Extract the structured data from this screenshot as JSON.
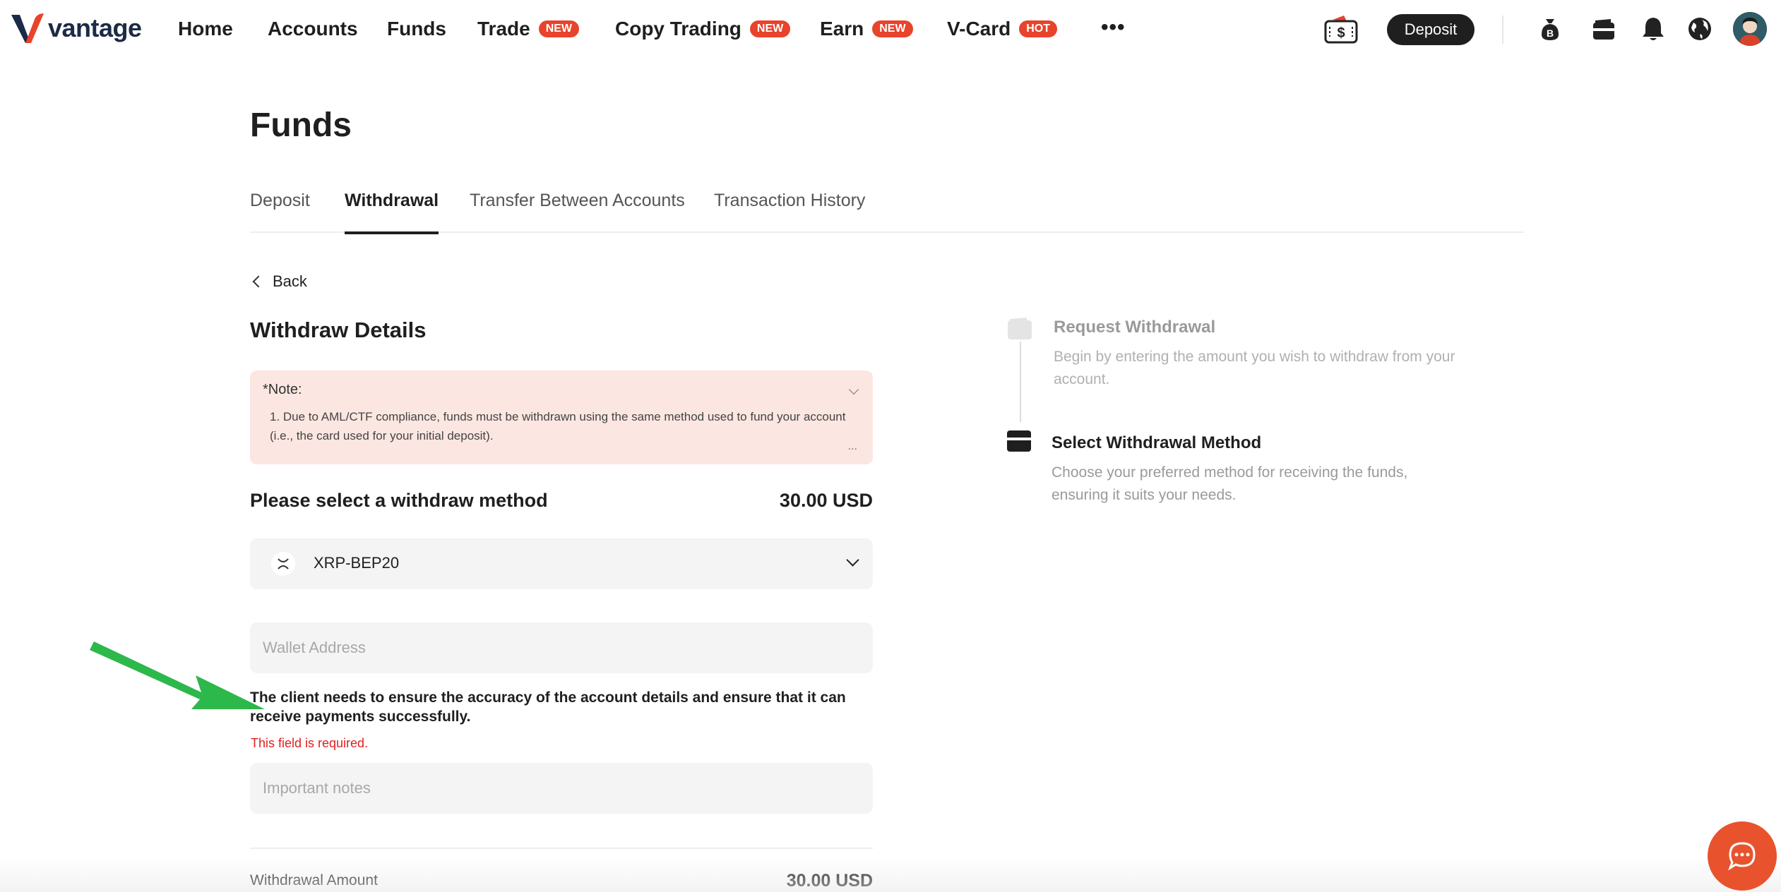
{
  "brand": {
    "logo_text": "vantage",
    "accent": "#e8432b"
  },
  "nav": {
    "items": [
      {
        "label": "Home",
        "badge": ""
      },
      {
        "label": "Accounts",
        "badge": ""
      },
      {
        "label": "Funds",
        "badge": ""
      },
      {
        "label": "Trade",
        "badge": "NEW"
      },
      {
        "label": "Copy Trading",
        "badge": "NEW"
      },
      {
        "label": "Earn",
        "badge": "NEW"
      },
      {
        "label": "V-Card",
        "badge": "HOT"
      }
    ],
    "more": "•••",
    "deposit_button": "Deposit",
    "icons": [
      "cashback-ticket-icon",
      "bitcoin-bag-icon",
      "wallet-icon",
      "bell-icon",
      "globe-icon",
      "avatar"
    ]
  },
  "page": {
    "title": "Funds",
    "tabs": [
      {
        "label": "Deposit",
        "active": false
      },
      {
        "label": "Withdrawal",
        "active": true
      },
      {
        "label": "Transfer Between Accounts",
        "active": false
      },
      {
        "label": "Transaction History",
        "active": false
      }
    ]
  },
  "form": {
    "back_label": "Back",
    "section_title": "Withdraw Details",
    "note": {
      "title": "*Note:",
      "text": "1. Due to AML/CTF compliance, funds must be withdrawn using the same method used to fund your account (i.e., the card used for your initial deposit).",
      "more": "..."
    },
    "method_label": "Please select a withdraw method",
    "method_amount": "30.00 USD",
    "selected_method": "XRP-BEP20",
    "wallet_placeholder": "Wallet Address",
    "wallet_value": "",
    "warning": "The client needs to ensure the accuracy of the account details and ensure that it can receive payments successfully.",
    "error": "This field is required.",
    "notes_placeholder": "Important notes",
    "amount_label": "Withdrawal Amount",
    "amount_value": "30.00 USD"
  },
  "steps": [
    {
      "title": "Request Withdrawal",
      "desc": "Begin by entering the amount you wish to withdraw from your account.",
      "state": "done"
    },
    {
      "title": "Select Withdrawal Method",
      "desc": "Choose your preferred method for receiving the funds, ensuring it suits your needs.",
      "state": "active"
    }
  ],
  "colors": {
    "note_bg": "#fbe6e1",
    "error": "#e02020",
    "annotation_arrow": "#2db84b",
    "chat_fab": "#e8532e"
  }
}
